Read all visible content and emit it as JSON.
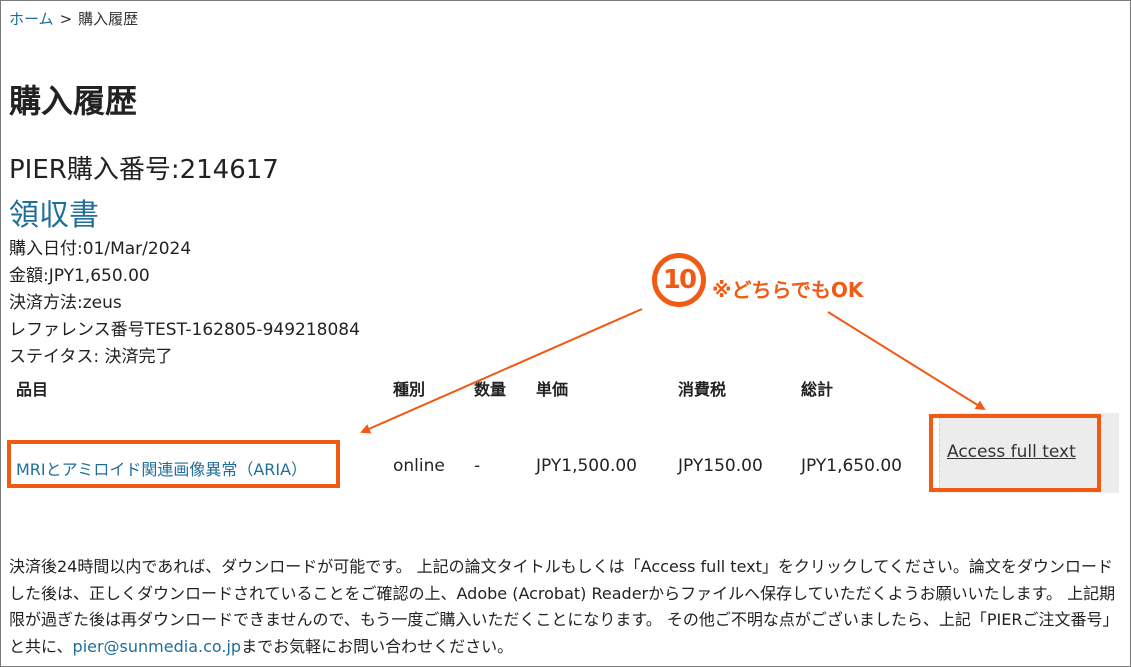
{
  "breadcrumb": {
    "home": "ホーム",
    "separator": ">",
    "current": "購入履歴"
  },
  "page_title": "購入履歴",
  "order": {
    "number_label": "PIER購入番号:214617",
    "receipt_link": "領収書"
  },
  "details": {
    "date": "購入日付:01/Mar/2024",
    "amount": "金額:JPY1,650.00",
    "payment": "決済方法:zeus",
    "reference": "レファレンス番号TEST-162805-949218084",
    "status": "ステイタス: 決済完了"
  },
  "table": {
    "headers": {
      "item": "品目",
      "type": "種別",
      "qty": "数量",
      "unit_price": "単価",
      "tax": "消費税",
      "total": "総計"
    },
    "row": {
      "title": "MRIとアミロイド関連画像異常（ARIA）",
      "type": "online",
      "qty": "-",
      "unit_price": "JPY1,500.00",
      "tax": "JPY150.00",
      "total": "JPY1,650.00",
      "access": "Access full text"
    }
  },
  "annotation": {
    "badge": "10",
    "note": "※どちらでもOK"
  },
  "footer": {
    "text_before_email": "決済後24時間以内であれば、ダウンロードが可能です。 上記の論文タイトルもしくは「Access full text」をクリックしてください。論文をダウンロードした後は、正しくダウンロードされていることをご確認の上、Adobe (Acrobat) Readerからファイルへ保存していただくようお願いいたします。 上記期限が過ぎた後は再ダウンロードできませんので、もう一度ご購入いただくことになります。 その他ご不明な点がございましたら、上記「PIERご注文番号」と共に、",
    "email": "pier@sunmedia.co.jp",
    "text_after_email": "までお気軽にお問い合わせください。"
  },
  "colors": {
    "link": "#1f6f9a",
    "annotation": "#f05a14",
    "cell_bg": "#ececec"
  }
}
